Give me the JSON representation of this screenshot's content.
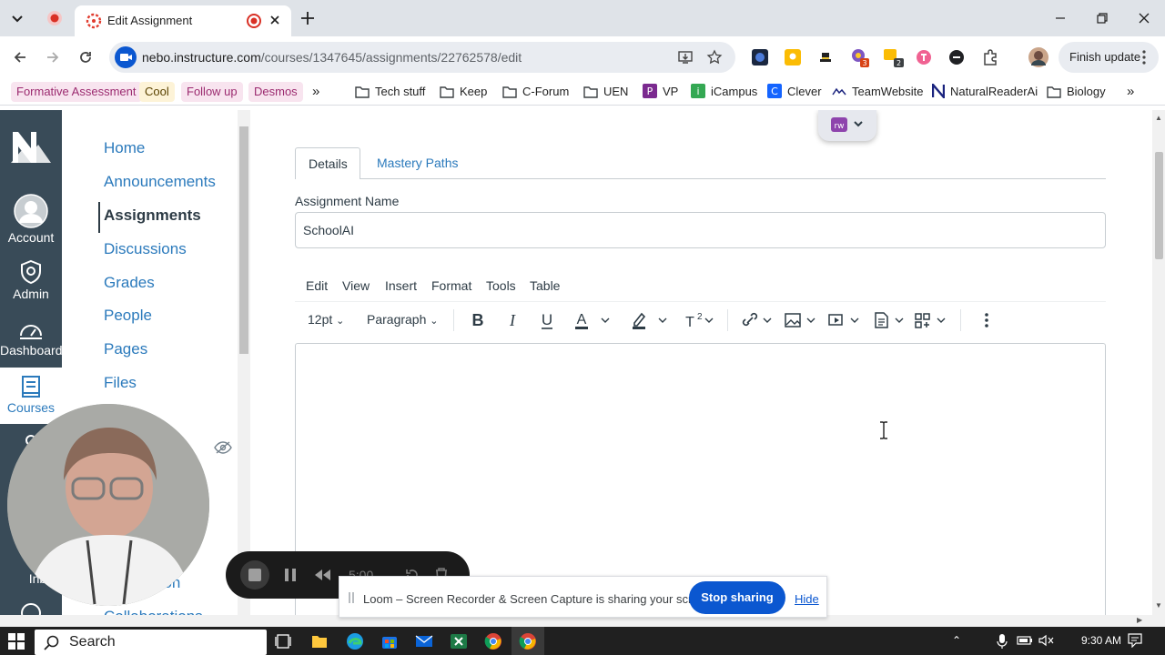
{
  "browser": {
    "tab_title": "Edit Assignment",
    "url_domain": "nebo.instructure.com",
    "url_path": "/courses/1347645/assignments/22762578/edit",
    "finish_update_label": "Finish update",
    "extension_badges": [
      "3",
      "2"
    ]
  },
  "bookmarks": [
    {
      "label": "Formative Assessment",
      "color": "#f8e4ef",
      "text_color": "#9b2a6f"
    },
    {
      "label": "Cool",
      "color": "#fdf3d7",
      "text_color": "#5a4200"
    },
    {
      "label": "Follow up",
      "color": "#f8e4ef",
      "text_color": "#9b2a6f"
    },
    {
      "label": "Desmos",
      "color": "#f8e4ef",
      "text_color": "#9b2a6f"
    },
    {
      "label": "Tech stuff"
    },
    {
      "label": "Keep"
    },
    {
      "label": "C-Forum"
    },
    {
      "label": "UEN"
    },
    {
      "label": "VP"
    },
    {
      "label": "iCampus"
    },
    {
      "label": "Clever"
    },
    {
      "label": "TeamWebsite"
    },
    {
      "label": "NaturalReaderAi"
    },
    {
      "label": "Biology"
    }
  ],
  "global_nav": {
    "items": [
      {
        "label": "Account",
        "icon": "account-icon"
      },
      {
        "label": "Admin",
        "icon": "admin-icon"
      },
      {
        "label": "Dashboard",
        "icon": "dashboard-icon"
      },
      {
        "label": "Courses",
        "icon": "courses-icon"
      },
      {
        "label": "Inbox",
        "icon": "inbox-icon"
      }
    ]
  },
  "course_nav": {
    "items": [
      "Home",
      "Announcements",
      "Assignments",
      "Discussions",
      "Grades",
      "People",
      "Pages",
      "Files"
    ],
    "active": "Assignments",
    "partial_items": [
      "tton",
      "Collaborations"
    ]
  },
  "editor": {
    "tabs": [
      "Details",
      "Mastery Paths"
    ],
    "name_label": "Assignment Name",
    "name_value": "SchoolAI",
    "menus": [
      "Edit",
      "View",
      "Insert",
      "Format",
      "Tools",
      "Table"
    ],
    "font_size": "12pt",
    "block_format": "Paragraph"
  },
  "loom": {
    "share_message": "Loom – Screen Recorder & Screen Capture is sharing your screen.",
    "stop_label": "Stop sharing",
    "hide_label": "Hide",
    "timer": "5:00"
  },
  "taskbar": {
    "search_label": "Search",
    "time": "9:30 AM"
  },
  "colors": {
    "canvas_nav": "#394b58",
    "canvas_link": "#2b7abc",
    "loom_stop": "#0b57d0"
  }
}
